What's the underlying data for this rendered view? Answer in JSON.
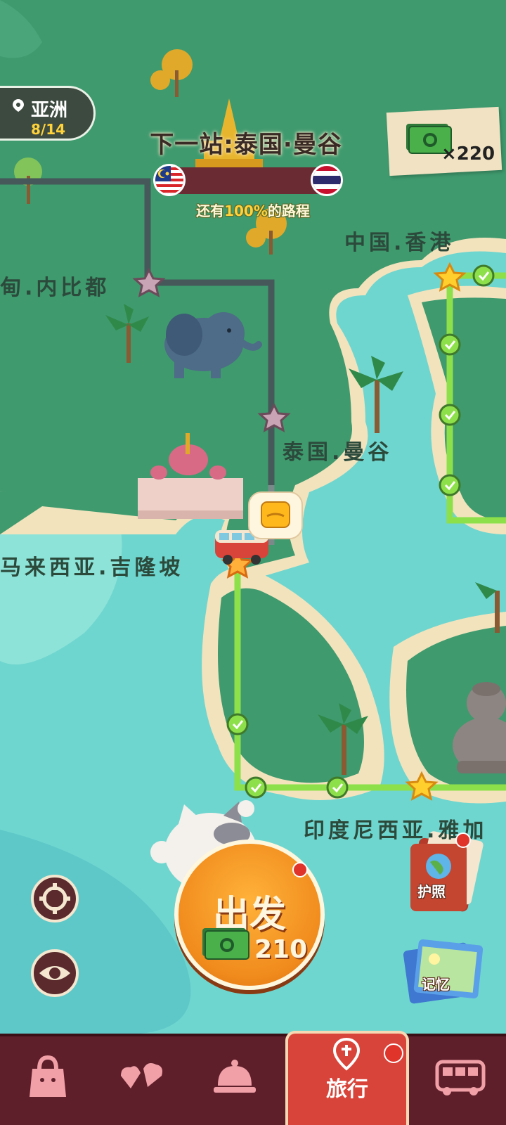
{
  "header": {
    "region_name": "亚洲",
    "region_progress": "8/14",
    "next_stop_title": "下一站:泰国·曼谷",
    "remaining_prefix": "还有",
    "remaining_percent": "100%",
    "remaining_suffix": "的路程",
    "from_flag": "malaysia-flag-icon",
    "to_flag": "thailand-flag-icon"
  },
  "currency": {
    "amount": "×220",
    "icon": "cash-bill-icon"
  },
  "map": {
    "labels": [
      "中国.香港",
      "缅甸.内比都",
      "泰国.曼谷",
      "马来西亚.吉隆坡",
      "印度尼西亚.雅加达"
    ],
    "visible_labels": [
      "中国.香港",
      "甸.内比都",
      "泰国.曼谷",
      "马来西亚.吉隆坡",
      "印度尼西亚.雅加"
    ],
    "colors": {
      "sea": "#6fd6cf",
      "land": "#3f9a6e",
      "sand": "#f2e3bd",
      "path_done": "#8ee04a",
      "path_todo": "#46585a"
    }
  },
  "actions": {
    "go_label": "出发",
    "go_cost": "210",
    "passport_label": "护照",
    "memory_label": "记忆"
  },
  "tabs": {
    "items": [
      "bag-icon",
      "heart-shapes-icon",
      "service-bell-icon",
      "旅行",
      "bus-icon"
    ],
    "active_label": "旅行"
  }
}
